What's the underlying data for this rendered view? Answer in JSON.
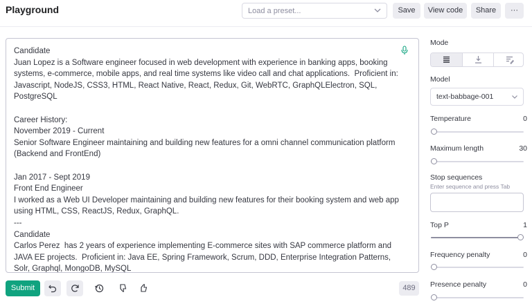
{
  "header": {
    "title": "Playground",
    "preset_placeholder": "Load a preset...",
    "save_label": "Save",
    "view_code_label": "View code",
    "share_label": "Share",
    "more_label": "···"
  },
  "editor": {
    "text": "Candidate\nJuan Lopez is a Software engineer focused in web development with experience in banking apps, booking systems, e-commerce, mobile apps, and real time systems like video call and chat applications.  Proficient in: Javascript, NodeJS, CSS3, HTML, React Native, React, Redux, Git, WebRTC, GraphQLElectron, SQL, PostgreSQL\n\nCareer History:\nNovember 2019 - Current\nSenior Software Engineer maintaining and building new features for a omni channel communication platform (Backend and FrontEnd)\n\nJan 2017 - Sept 2019\nFront End Engineer\nI worked as a Web UI Developer maintaining and building new features for their booking system and web app using HTML, CSS, ReactJS, Redux, GraphQL.\n---\nCandidate\nCarlos Perez  has 2 years of experience implementing E-commerce sites with SAP commerce platform and JAVA EE projects.  Proficient in: Java EE, Spring Framework, Scrum, DDD, Enterprise Integration Patterns, Solr, Graphql, MongoDB, MySQL"
  },
  "footer": {
    "submit_label": "Submit",
    "token_count": "489"
  },
  "panel": {
    "mode_label": "Mode",
    "mode_options": [
      "complete",
      "insert",
      "edit"
    ],
    "mode_selected": "complete",
    "model_label": "Model",
    "model_value": "text-babbage-001",
    "temperature": {
      "label": "Temperature",
      "value": "0",
      "level": 0
    },
    "max_length": {
      "label": "Maximum length",
      "value": "30",
      "level": 0.01
    },
    "stop_sequences": {
      "label": "Stop sequences",
      "hint": "Enter sequence and press Tab"
    },
    "top_p": {
      "label": "Top P",
      "value": "1",
      "level": 1
    },
    "frequency_penalty": {
      "label": "Frequency penalty",
      "value": "0",
      "level": 0
    },
    "presence_penalty": {
      "label": "Presence penalty",
      "value": "0",
      "level": 0
    }
  },
  "colors": {
    "accent": "#10a37f",
    "border": "#d9d9e3",
    "button_bg": "#ececf1"
  },
  "icons": [
    "chevron-down-icon",
    "microphone-icon",
    "undo-icon",
    "redo-icon",
    "history-icon",
    "thumbs-down-icon",
    "thumbs-up-icon",
    "mode-complete-icon",
    "mode-insert-icon",
    "mode-edit-icon"
  ]
}
